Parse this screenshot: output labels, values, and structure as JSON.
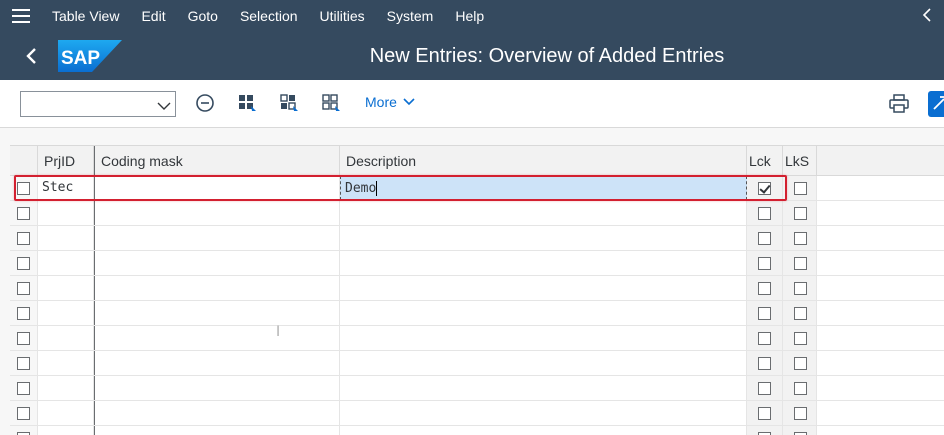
{
  "menubar": {
    "items": [
      "Table View",
      "Edit",
      "Goto",
      "Selection",
      "Utilities",
      "System",
      "Help"
    ],
    "hamburger_icon": "menu-icon",
    "collapse_icon": "chevron-left-icon"
  },
  "titlebar": {
    "title": "New Entries: Overview of Added Entries",
    "logo_text": "SAP",
    "back_icon": "chevron-left-icon"
  },
  "toolbar": {
    "select_value": "",
    "more_label": "More",
    "icons": [
      "remove-icon",
      "select-all-icon",
      "select-block-icon",
      "deselect-all-icon",
      "print-icon",
      "customize-icon"
    ]
  },
  "table": {
    "columns": [
      "PrjID",
      "Coding mask",
      "Description",
      "Lck",
      "LkS"
    ],
    "rows": [
      {
        "prjid": "Stec",
        "coding_mask": "",
        "description": "Demo",
        "lck": true,
        "lks": false
      },
      {
        "prjid": "",
        "coding_mask": "",
        "description": "",
        "lck": false,
        "lks": false
      },
      {
        "prjid": "",
        "coding_mask": "",
        "description": "",
        "lck": false,
        "lks": false
      },
      {
        "prjid": "",
        "coding_mask": "",
        "description": "",
        "lck": false,
        "lks": false
      },
      {
        "prjid": "",
        "coding_mask": "",
        "description": "",
        "lck": false,
        "lks": false
      },
      {
        "prjid": "",
        "coding_mask": "",
        "description": "",
        "lck": false,
        "lks": false
      },
      {
        "prjid": "",
        "coding_mask": "",
        "description": "",
        "lck": false,
        "lks": false
      },
      {
        "prjid": "",
        "coding_mask": "",
        "description": "",
        "lck": false,
        "lks": false
      },
      {
        "prjid": "",
        "coding_mask": "",
        "description": "",
        "lck": false,
        "lks": false
      },
      {
        "prjid": "",
        "coding_mask": "",
        "description": "",
        "lck": false,
        "lks": false
      },
      {
        "prjid": "",
        "coding_mask": "",
        "description": "",
        "lck": false,
        "lks": false
      }
    ]
  },
  "colors": {
    "shell": "#354a5f",
    "accent": "#0a6ed1",
    "highlight": "#d32030",
    "selected_cell": "#cde3f8"
  }
}
